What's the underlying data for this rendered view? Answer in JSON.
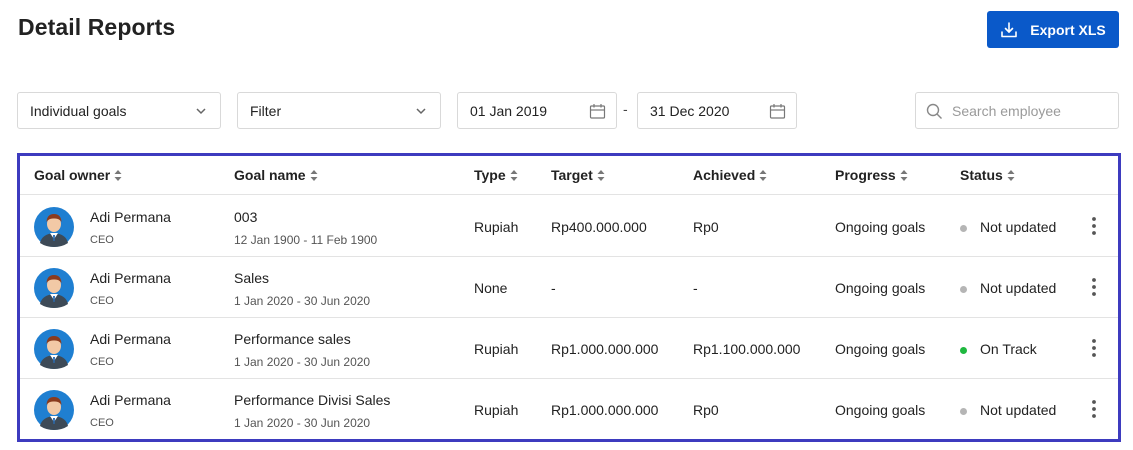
{
  "page": {
    "title": "Detail Reports"
  },
  "export_button": {
    "label": "Export XLS",
    "icon": "download-icon"
  },
  "filters": {
    "goal_type": {
      "value": "Individual goals",
      "icon": "chevron-down-icon"
    },
    "filter": {
      "value": "Filter",
      "icon": "chevron-down-icon"
    },
    "date_start": {
      "value": "01 Jan 2019",
      "icon": "calendar-icon"
    },
    "date_separator": "-",
    "date_end": {
      "value": "31 Dec 2020",
      "icon": "calendar-icon"
    },
    "search": {
      "placeholder": "Search employee",
      "icon": "search-icon"
    }
  },
  "table": {
    "headers": [
      "Goal owner",
      "Goal name",
      "Type",
      "Target",
      "Achieved",
      "Progress",
      "Status"
    ],
    "rows": [
      {
        "owner": "Adi Permana",
        "role": "CEO",
        "goal": "003",
        "period": "12 Jan 1900 - 11 Feb 1900",
        "type": "Rupiah",
        "target": "Rp400.000.000",
        "achieved": "Rp0",
        "progress": "Ongoing goals",
        "status": "Not updated",
        "status_color": "#b5b5b5"
      },
      {
        "owner": "Adi Permana",
        "role": "CEO",
        "goal": "Sales",
        "period": "1 Jan 2020 - 30 Jun 2020",
        "type": "None",
        "target": "-",
        "achieved": "-",
        "progress": "Ongoing goals",
        "status": "Not updated",
        "status_color": "#b5b5b5"
      },
      {
        "owner": "Adi Permana",
        "role": "CEO",
        "goal": "Performance sales",
        "period": "1 Jan 2020 - 30 Jun 2020",
        "type": "Rupiah",
        "target": "Rp1.000.000.000",
        "achieved": "Rp1.100.000.000",
        "progress": "Ongoing goals",
        "status": "On Track",
        "status_color": "#1fb83f"
      },
      {
        "owner": "Adi Permana",
        "role": "CEO",
        "goal": "Performance Divisi Sales",
        "period": "1 Jan 2020 - 30 Jun 2020",
        "type": "Rupiah",
        "target": "Rp1.000.000.000",
        "achieved": "Rp0",
        "progress": "Ongoing goals",
        "status": "Not updated",
        "status_color": "#b5b5b5"
      }
    ]
  },
  "colors": {
    "primary": "#0a59c9",
    "table_outline": "#3d3bbf"
  }
}
